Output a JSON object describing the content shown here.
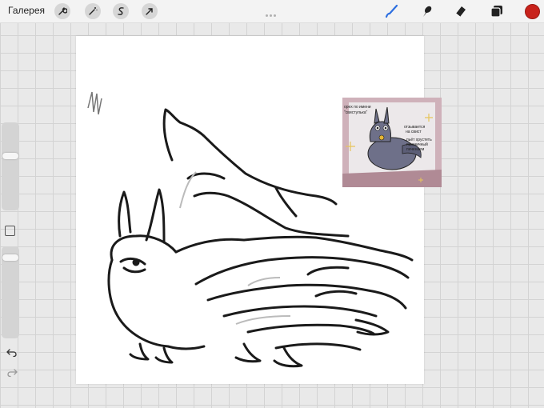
{
  "topbar": {
    "gallery_label": "Галерея",
    "left_tools": [
      "wrench-icon",
      "magic-wand-icon",
      "selection-icon",
      "transform-arrow-icon"
    ],
    "right_tools": [
      "brush-icon",
      "smudge-icon",
      "eraser-icon",
      "layers-icon"
    ],
    "active_color": "#c8221b",
    "accent_color": "#2d6fe0"
  },
  "reference": {
    "text_1": "орех по имени",
    "text_2": "\"свистулька\"",
    "text_3": "отзывается",
    "text_4": "на свист",
    "text_5": "пьёт хрустеть",
    "text_6": "пшеничный",
    "text_7": "печеньем"
  },
  "sidebar": {
    "icons": [
      "modify-square-icon",
      "undo-icon",
      "redo-icon"
    ]
  }
}
